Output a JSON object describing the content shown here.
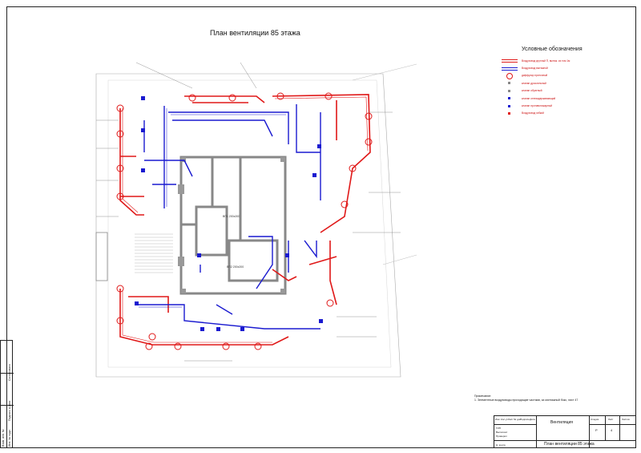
{
  "title": "План вентиляции  85 этажа",
  "legend": {
    "title": "Условные обозначения",
    "items": [
      {
        "label": "Воздуховод круглый П, вытяж. из том 1м",
        "symbol": "red-double-line"
      },
      {
        "label": "Воздуховод вытяжной",
        "symbol": "blue-double-line"
      },
      {
        "label": "диффузор приточный",
        "symbol": "red-diffuser"
      },
      {
        "label": "клапан дроссельный",
        "symbol": "small-square"
      },
      {
        "label": "клапан обратный",
        "symbol": "small-square"
      },
      {
        "label": "клапан огнезадерживающий",
        "symbol": "blue-square"
      },
      {
        "label": "клапан противопожарный",
        "symbol": "blue-square"
      },
      {
        "label": "Воздуховод гибкий",
        "symbol": "small-square"
      }
    ]
  },
  "plan_labels": {
    "room_1": "ВП1 200х200",
    "room_2": "ВП2 200х200"
  },
  "notes": {
    "heading": "Примечание:",
    "line_1": "1. Элементные воздуховоды проходящие частями, за монтажный бокс, лист 47"
  },
  "stamp": {
    "section": "Вентиляция",
    "sheet_title": "План вентиляции 85 этажа",
    "stage_label": "Стадия",
    "sheet_label": "Лист",
    "sheets_label": "Листов",
    "stage_value": "Р",
    "sheet_value": "4",
    "col_headers": [
      "Изм",
      "Кол.уч",
      "Лист",
      "№ док",
      "Подпись",
      "Дата"
    ],
    "roles": [
      "ГИП",
      "Выполнил",
      "Проверил",
      "Н. контр."
    ]
  },
  "side_stamp": [
    "Инв. № подл.",
    "Подпись и дата",
    "Взам. инв. №",
    "Согласовано"
  ],
  "colors": {
    "supply": "#e01818",
    "exhaust": "#1a1ad0",
    "wall": "#888888",
    "line": "#222222"
  }
}
